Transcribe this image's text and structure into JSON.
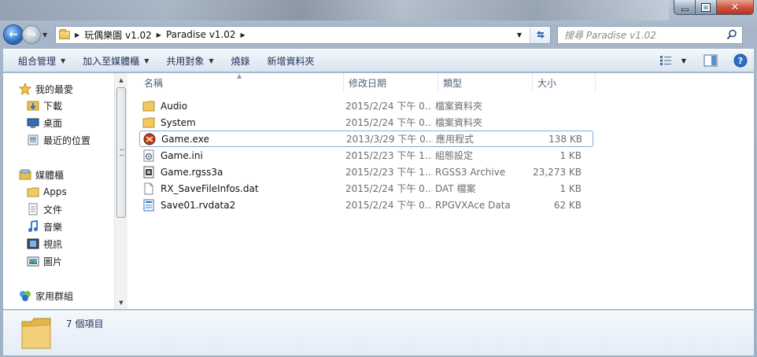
{
  "window": {
    "minimize_label": "minimize",
    "maximize_label": "maximize",
    "close_label": "close"
  },
  "address": {
    "crumbs": [
      "玩偶樂園 v1.02",
      "Paradise v1.02"
    ]
  },
  "search": {
    "placeholder": "搜尋 Paradise v1.02"
  },
  "commands": {
    "organize": "組合管理",
    "include_in_library": "加入至媒體櫃",
    "share_with": "共用對象",
    "burn": "燒錄",
    "new_folder": "新增資料夾"
  },
  "nav": {
    "favorites": "我的最愛",
    "downloads": "下載",
    "desktop": "桌面",
    "recent_places": "最近的位置",
    "libraries": "媒體櫃",
    "apps": "Apps",
    "documents": "文件",
    "music": "音樂",
    "videos": "視訊",
    "pictures": "圖片",
    "homegroup": "家用群組"
  },
  "columns": {
    "name": "名稱",
    "date_modified": "修改日期",
    "type": "類型",
    "size": "大小"
  },
  "files": [
    {
      "name": "Audio",
      "date": "2015/2/24 下午 0...",
      "type": "檔案資料夾",
      "size": "",
      "icon": "folder-icon"
    },
    {
      "name": "System",
      "date": "2015/2/24 下午 0...",
      "type": "檔案資料夾",
      "size": "",
      "icon": "folder-icon"
    },
    {
      "name": "Game.exe",
      "date": "2013/3/29 下午 0...",
      "type": "應用程式",
      "size": "138 KB",
      "icon": "exe-icon",
      "selected": true
    },
    {
      "name": "Game.ini",
      "date": "2015/2/23 下午 1...",
      "type": "組態設定",
      "size": "1 KB",
      "icon": "ini-file-icon"
    },
    {
      "name": "Game.rgss3a",
      "date": "2015/2/23 下午 1...",
      "type": "RGSS3 Archive",
      "size": "23,273 KB",
      "icon": "archive-file-icon"
    },
    {
      "name": "RX_SaveFileInfos.dat",
      "date": "2015/2/24 下午 0...",
      "type": "DAT 檔案",
      "size": "1 KB",
      "icon": "blank-file-icon"
    },
    {
      "name": "Save01.rvdata2",
      "date": "2015/2/24 下午 0...",
      "type": "RPGVXAce Data",
      "size": "62 KB",
      "icon": "data-file-icon"
    }
  ],
  "status": {
    "item_count": "7 個項目"
  },
  "colors": {
    "accent": "#2d6fc4",
    "selection_border": "#84acdd",
    "folder": "#e7bb4f"
  }
}
